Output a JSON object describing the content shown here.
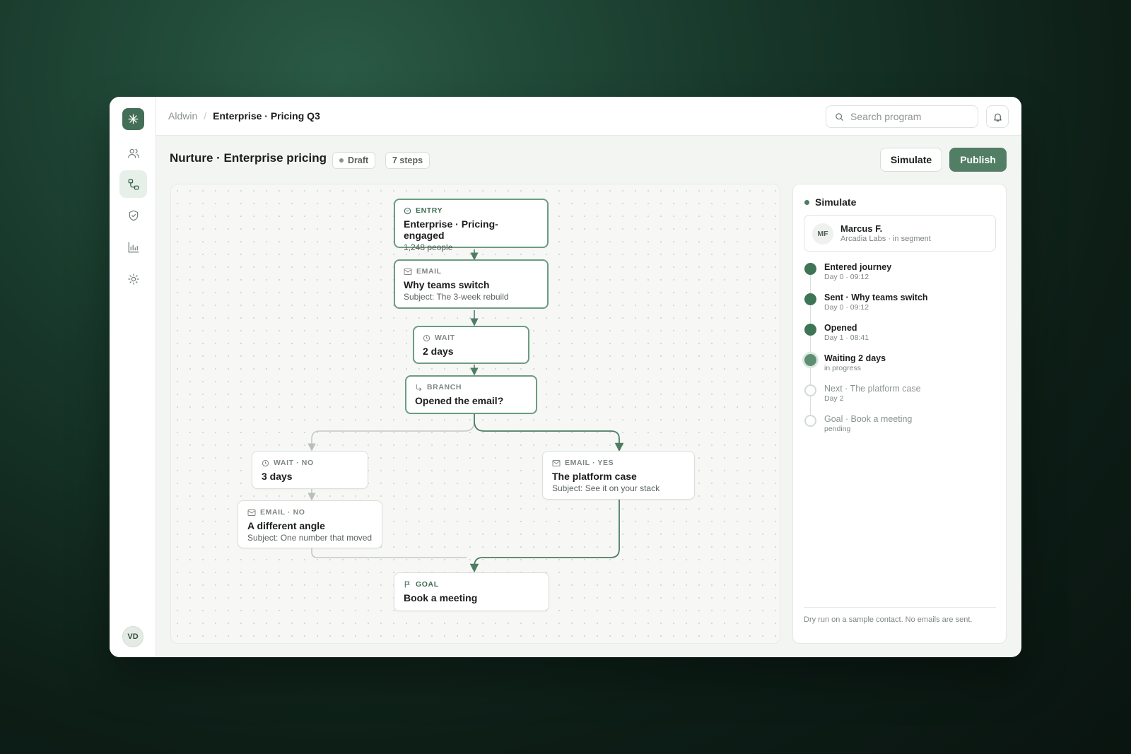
{
  "breadcrumb": {
    "workspace": "Aldwin",
    "separator": "/",
    "program": "Enterprise · Pricing Q3"
  },
  "search": {
    "placeholder": "Search program"
  },
  "user": {
    "initials": "VD"
  },
  "journey": {
    "title": "Nurture · Enterprise pricing",
    "status": "Draft",
    "steps": "7 steps",
    "simulate_label": "Simulate",
    "publish_label": "Publish"
  },
  "nodes": {
    "entry": {
      "kind": "ENTRY",
      "title": "Enterprise · Pricing-engaged",
      "sub": "1,248 people"
    },
    "email1": {
      "kind": "EMAIL",
      "title": "Why teams switch",
      "sub": "Subject: The 3-week rebuild"
    },
    "wait1": {
      "kind": "WAIT",
      "title": "2 days"
    },
    "branch": {
      "kind": "BRANCH",
      "title": "Opened the email?"
    },
    "wait_no": {
      "kind": "WAIT · NO",
      "title": "3 days"
    },
    "email_no": {
      "kind": "EMAIL · NO",
      "title": "A different angle",
      "sub": "Subject: One number that moved"
    },
    "email_yes": {
      "kind": "EMAIL · YES",
      "title": "The platform case",
      "sub": "Subject: See it on your stack"
    },
    "goal": {
      "kind": "GOAL",
      "title": "Book a meeting"
    }
  },
  "simulate": {
    "heading": "Simulate",
    "contact": {
      "initials": "MF",
      "name": "Marcus F.",
      "segment": "Arcadia Labs · in segment"
    },
    "timeline": [
      {
        "title": "Entered journey",
        "meta": "Day 0 · 09:12",
        "state": "done"
      },
      {
        "title": "Sent · Why teams switch",
        "meta": "Day 0 · 09:12",
        "state": "done"
      },
      {
        "title": "Opened",
        "meta": "Day 1 · 08:41",
        "state": "done"
      },
      {
        "title": "Waiting 2 days",
        "meta": "in progress",
        "state": "current"
      },
      {
        "title": "Next · The platform case",
        "meta": "Day 2",
        "state": "pending"
      },
      {
        "title": "Goal · Book a meeting",
        "meta": "pending",
        "state": "pending"
      }
    ],
    "footer": "Dry run on a sample contact. No emails are sent."
  },
  "colors": {
    "accent": "#527e66",
    "accent_dark": "#3f7557",
    "rail_active": "#e6efe8"
  },
  "icons": [
    "sparkle-logo-icon",
    "people-icon",
    "flow-icon",
    "shield-icon",
    "chart-icon",
    "gear-icon",
    "search-icon",
    "bell-icon",
    "clock-icon",
    "mail-icon",
    "branch-icon",
    "flag-icon",
    "entry-icon"
  ]
}
